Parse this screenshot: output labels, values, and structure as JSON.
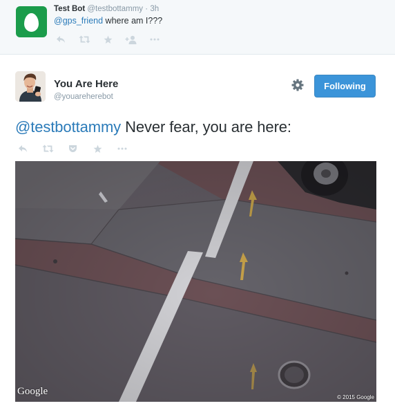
{
  "parent_tweet": {
    "name": "Test Bot",
    "handle": "@testbottammy",
    "separator": "·",
    "time": "3h",
    "mention": "@gps_friend",
    "text": " where am I???",
    "actions": [
      "reply-icon",
      "retweet-icon",
      "favorite-icon",
      "follow-icon",
      "more-icon"
    ]
  },
  "main_tweet": {
    "name": "You Are Here",
    "handle": "@youareherebot",
    "follow_label": "Following",
    "mention": "@testbottammy",
    "text": " Never fear, you are here:",
    "actions": [
      "reply-icon",
      "retweet-icon",
      "pocket-icon",
      "favorite-icon",
      "more-icon"
    ]
  },
  "photo": {
    "watermark": "Google",
    "copyright": "© 2015 Google"
  },
  "colors": {
    "link": "#2b7bb9",
    "button": "#3b94d9",
    "muted": "#8899a6",
    "egg_avatar": "#1b9c4b",
    "action_icons": "#ccd6dd"
  }
}
